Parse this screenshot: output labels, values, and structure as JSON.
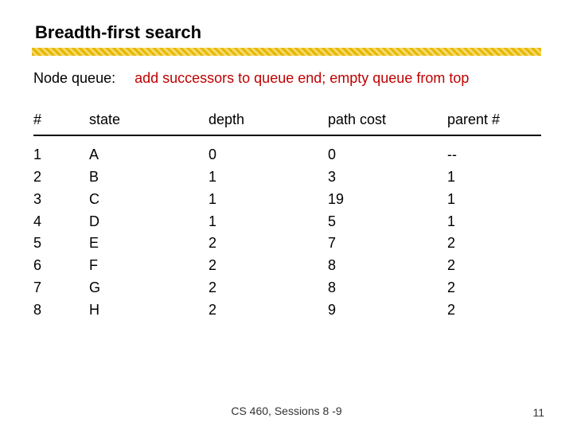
{
  "title": "Breadth-first search",
  "queue": {
    "label": "Node queue:",
    "description": "add successors to queue end; empty queue from top"
  },
  "table": {
    "headers": {
      "num": "#",
      "state": "state",
      "depth": "depth",
      "path_cost": "path cost",
      "parent": "parent #"
    },
    "rows": [
      {
        "num": "1",
        "state": "A",
        "depth": "0",
        "path_cost": "0",
        "parent": "--"
      },
      {
        "num": "2",
        "state": "B",
        "depth": "1",
        "path_cost": "3",
        "parent": "1"
      },
      {
        "num": "3",
        "state": "C",
        "depth": "1",
        "path_cost": "19",
        "parent": "1"
      },
      {
        "num": "4",
        "state": "D",
        "depth": "1",
        "path_cost": "5",
        "parent": "1"
      },
      {
        "num": "5",
        "state": "E",
        "depth": "2",
        "path_cost": "7",
        "parent": "2"
      },
      {
        "num": "6",
        "state": "F",
        "depth": "2",
        "path_cost": "8",
        "parent": "2"
      },
      {
        "num": "7",
        "state": "G",
        "depth": "2",
        "path_cost": "8",
        "parent": "2"
      },
      {
        "num": "8",
        "state": "H",
        "depth": "2",
        "path_cost": "9",
        "parent": "2"
      }
    ]
  },
  "footer": {
    "text": "CS 460,  Sessions 8 -9",
    "page_number": "11"
  }
}
